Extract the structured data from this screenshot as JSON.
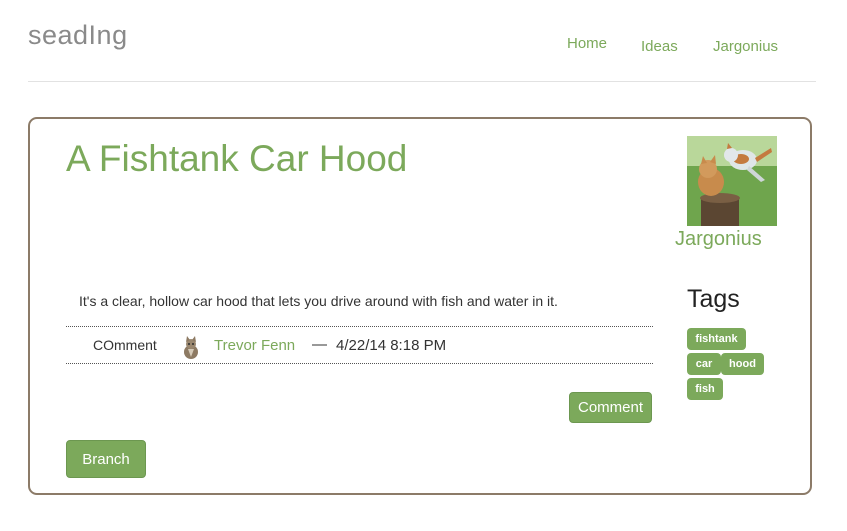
{
  "header": {
    "brand": "seadIng",
    "nav": {
      "home": "Home",
      "ideas": "Ideas",
      "jargonius": "Jargonius"
    }
  },
  "idea": {
    "title": "A Fishtank Car Hood",
    "owner": "Jargonius",
    "description": "It's a clear, hollow car hood that lets you drive around with fish and water in it."
  },
  "comment": {
    "label": "COmment",
    "author": "Trevor Fenn",
    "separator": "—",
    "timestamp": "4/22/14 8:18 PM"
  },
  "buttons": {
    "comment": "Comment",
    "branch": "Branch"
  },
  "tags": {
    "heading": "Tags",
    "items": [
      "fishtank",
      "car",
      "hood",
      "fish"
    ]
  },
  "colors": {
    "accent": "#7ca95b",
    "card_border": "#8c7b68",
    "brand_text": "#8a8a8a"
  },
  "icons": {
    "owner_avatar": "kittens-photo-icon",
    "comment_avatar": "cat-photo-icon"
  }
}
